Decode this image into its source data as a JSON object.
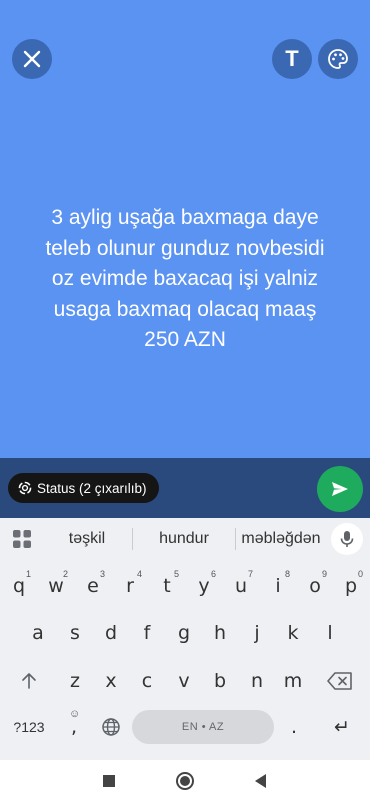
{
  "status": {
    "text_lines": [
      "3 aylig uşağa baxmaga daye",
      "teleb olunur gunduz novbesidi",
      "oz evimde baxacaq işi yalniz",
      "usaga baxmaq olacaq maaş",
      "250 AZN"
    ],
    "background_color": "#5b93f2"
  },
  "toolbar": {
    "close_icon": "close-icon",
    "text_button_label": "T",
    "palette_icon": "palette-icon"
  },
  "audience": {
    "chip_label": "Status (2 çıxarılıb)",
    "send_icon": "send-icon"
  },
  "keyboard": {
    "suggestions": [
      "təşkil",
      "hundur",
      "məbləğdən"
    ],
    "row1": [
      "q",
      "w",
      "e",
      "r",
      "t",
      "y",
      "u",
      "i",
      "o",
      "p"
    ],
    "row1_hints": [
      "1",
      "2",
      "3",
      "4",
      "5",
      "6",
      "7",
      "8",
      "9",
      "0"
    ],
    "row2": [
      "a",
      "s",
      "d",
      "f",
      "g",
      "h",
      "j",
      "k",
      "l"
    ],
    "row3": [
      "z",
      "x",
      "c",
      "v",
      "b",
      "n",
      "m"
    ],
    "symbols_label": "?123",
    "comma_label": ",",
    "comma_hint": "☺",
    "space_label": "EN • AZ",
    "period_label": ".",
    "enter_label": "↵"
  }
}
